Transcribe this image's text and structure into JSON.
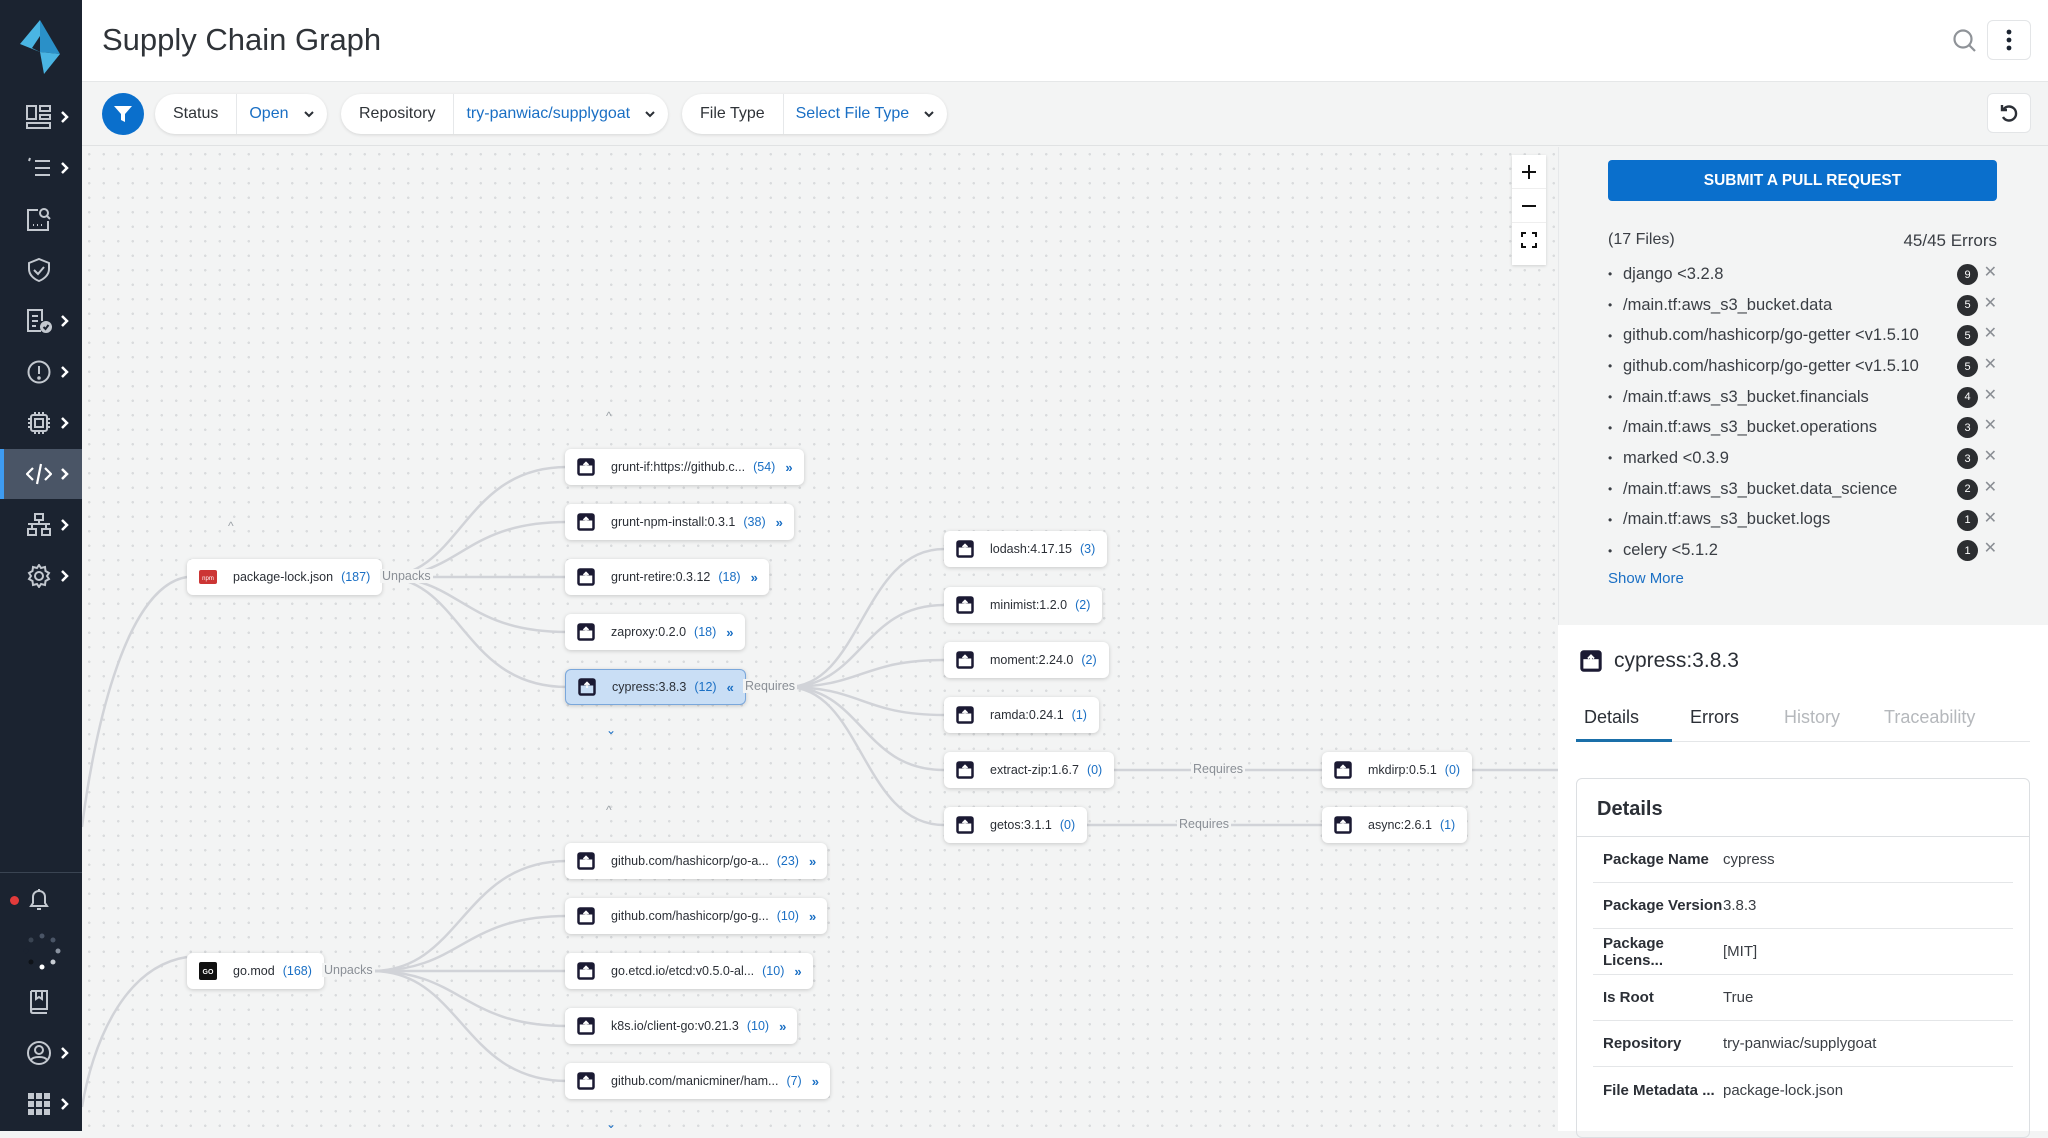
{
  "header": {
    "title": "Supply Chain Graph"
  },
  "sidebar": {
    "items": [
      {
        "name": "dashboards",
        "icon": "dashboard-icon",
        "has_chevron": true
      },
      {
        "name": "activity",
        "icon": "list-icon",
        "has_chevron": true
      },
      {
        "name": "investigate",
        "icon": "search-doc-icon",
        "has_chevron": false
      },
      {
        "name": "policies",
        "icon": "shield-check-icon",
        "has_chevron": false
      },
      {
        "name": "compliance",
        "icon": "report-check-icon",
        "has_chevron": true
      },
      {
        "name": "alerts",
        "icon": "alert-circle-icon",
        "has_chevron": true
      },
      {
        "name": "compute",
        "icon": "chip-icon",
        "has_chevron": true
      },
      {
        "name": "code-security",
        "icon": "code-icon",
        "has_chevron": true,
        "active": true
      },
      {
        "name": "network",
        "icon": "network-icon",
        "has_chevron": true
      },
      {
        "name": "settings",
        "icon": "gear-icon",
        "has_chevron": true
      }
    ]
  },
  "filters": {
    "status": {
      "label": "Status",
      "value": "Open"
    },
    "repository": {
      "label": "Repository",
      "value": "try-panwiac/supplygoat"
    },
    "file_type": {
      "label": "File Type",
      "value": "Select File Type"
    }
  },
  "graph": {
    "roots": [
      {
        "name": "package-lock.json",
        "count": "(187)",
        "icon": "npm-icon",
        "edge_label": "Unpacks"
      },
      {
        "name": "go.mod",
        "count": "(168)",
        "icon": "go-icon",
        "edge_label": "Unpacks"
      }
    ],
    "npm_children": [
      {
        "name": "grunt-if:https://github.c...",
        "count": "(54)",
        "expand": "»"
      },
      {
        "name": "grunt-npm-install:0.3.1",
        "count": "(38)",
        "expand": "»"
      },
      {
        "name": "grunt-retire:0.3.12",
        "count": "(18)",
        "expand": "»"
      },
      {
        "name": "zaproxy:0.2.0",
        "count": "(18)",
        "expand": "»"
      },
      {
        "name": "cypress:3.8.3",
        "count": "(12)",
        "expand": "«",
        "selected": true
      }
    ],
    "cypress_edge_label": "Requires",
    "cypress_children": [
      {
        "name": "lodash:4.17.15",
        "count": "(3)"
      },
      {
        "name": "minimist:1.2.0",
        "count": "(2)"
      },
      {
        "name": "moment:2.24.0",
        "count": "(2)"
      },
      {
        "name": "ramda:0.24.1",
        "count": "(1)"
      },
      {
        "name": "extract-zip:1.6.7",
        "count": "(0)"
      },
      {
        "name": "getos:3.1.1",
        "count": "(0)"
      }
    ],
    "third_level": [
      {
        "name": "mkdirp:0.5.1",
        "count": "(0)",
        "edge_label": "Requires"
      },
      {
        "name": "async:2.6.1",
        "count": "(1)",
        "edge_label": "Requires"
      }
    ],
    "go_children": [
      {
        "name": "github.com/hashicorp/go-a...",
        "count": "(23)",
        "expand": "»"
      },
      {
        "name": "github.com/hashicorp/go-g...",
        "count": "(10)",
        "expand": "»"
      },
      {
        "name": "go.etcd.io/etcd:v0.5.0-al...",
        "count": "(10)",
        "expand": "»"
      },
      {
        "name": "k8s.io/client-go:v0.21.3",
        "count": "(10)",
        "expand": "»"
      },
      {
        "name": "github.com/manicminer/ham...",
        "count": "(7)",
        "expand": "»"
      }
    ],
    "carets": {
      "up": "^",
      "down": "⌄"
    }
  },
  "pr_panel": {
    "submit_label": "SUBMIT A PULL REQUEST",
    "files": "(17 Files)",
    "errors": "45/45 Errors",
    "items": [
      {
        "text": "django <3.2.8",
        "count": "9"
      },
      {
        "text": "/main.tf:aws_s3_bucket.data",
        "count": "5"
      },
      {
        "text": "github.com/hashicorp/go-getter <v1.5.10",
        "count": "5"
      },
      {
        "text": "github.com/hashicorp/go-getter <v1.5.10",
        "count": "5"
      },
      {
        "text": "/main.tf:aws_s3_bucket.financials",
        "count": "4"
      },
      {
        "text": "/main.tf:aws_s3_bucket.operations",
        "count": "3"
      },
      {
        "text": "marked <0.3.9",
        "count": "3"
      },
      {
        "text": "/main.tf:aws_s3_bucket.data_science",
        "count": "2"
      },
      {
        "text": "/main.tf:aws_s3_bucket.logs",
        "count": "1"
      },
      {
        "text": "celery <5.1.2",
        "count": "1"
      }
    ],
    "show_more": "Show More"
  },
  "details": {
    "title": "cypress:3.8.3",
    "tabs": [
      "Details",
      "Errors",
      "History",
      "Traceability"
    ],
    "card_title": "Details",
    "rows": [
      {
        "key": "Package Name",
        "value": "cypress"
      },
      {
        "key": "Package Version",
        "value": "3.8.3"
      },
      {
        "key": "Package Licens...",
        "value": "[MIT]"
      },
      {
        "key": "Is Root",
        "value": "True"
      },
      {
        "key": "Repository",
        "value": "try-panwiac/supplygoat"
      },
      {
        "key": "File Metadata ...",
        "value": "package-lock.json"
      }
    ]
  },
  "colors": {
    "accent": "#0a6fcc",
    "sidebar": "#1b2330",
    "link": "#1a6fc4",
    "selected_node": "#c9def5",
    "alert_dot": "#e23b3b"
  }
}
